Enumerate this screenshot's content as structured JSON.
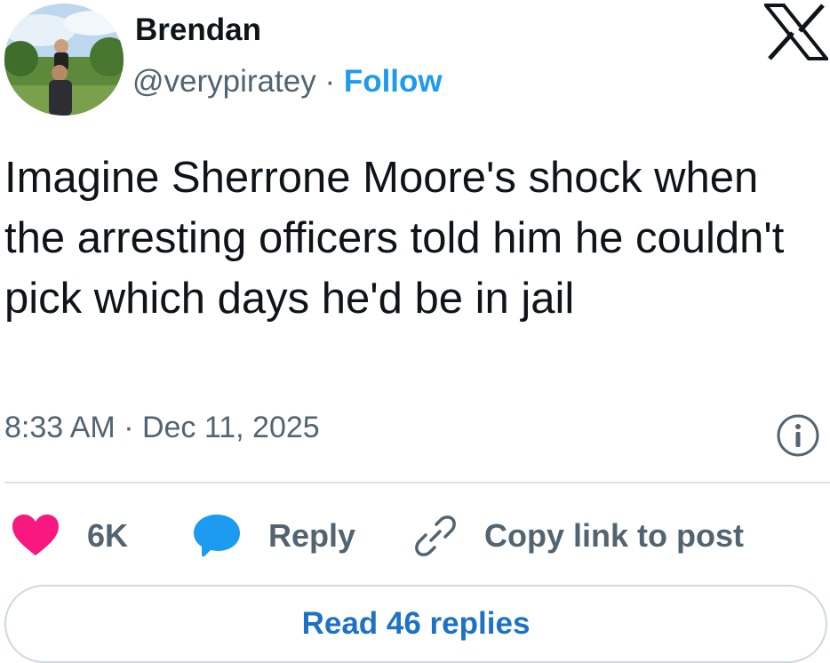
{
  "author": {
    "name": "Brendan",
    "handle": "@verypiratey",
    "separator": "·",
    "follow_label": "Follow"
  },
  "tweet": {
    "text": "Imagine Sherrone Moore's shock when the arresting officers told him he couldn't pick which days he'd be in jail",
    "timestamp": "8:33 AM · Dec 11, 2025"
  },
  "actions": {
    "like_count": "6K",
    "reply_label": "Reply",
    "copy_link_label": "Copy link to post"
  },
  "read_replies_label": "Read 46 replies",
  "icons": {
    "logo": "x-logo-icon",
    "info": "info-icon",
    "like": "heart-icon",
    "reply": "speech-bubble-icon",
    "copy": "link-icon"
  },
  "colors": {
    "heart": "#f91880",
    "reply_bubble": "#1d9bf0",
    "link_blue": "#1d9bf0",
    "read_replies": "#1d72c4"
  }
}
